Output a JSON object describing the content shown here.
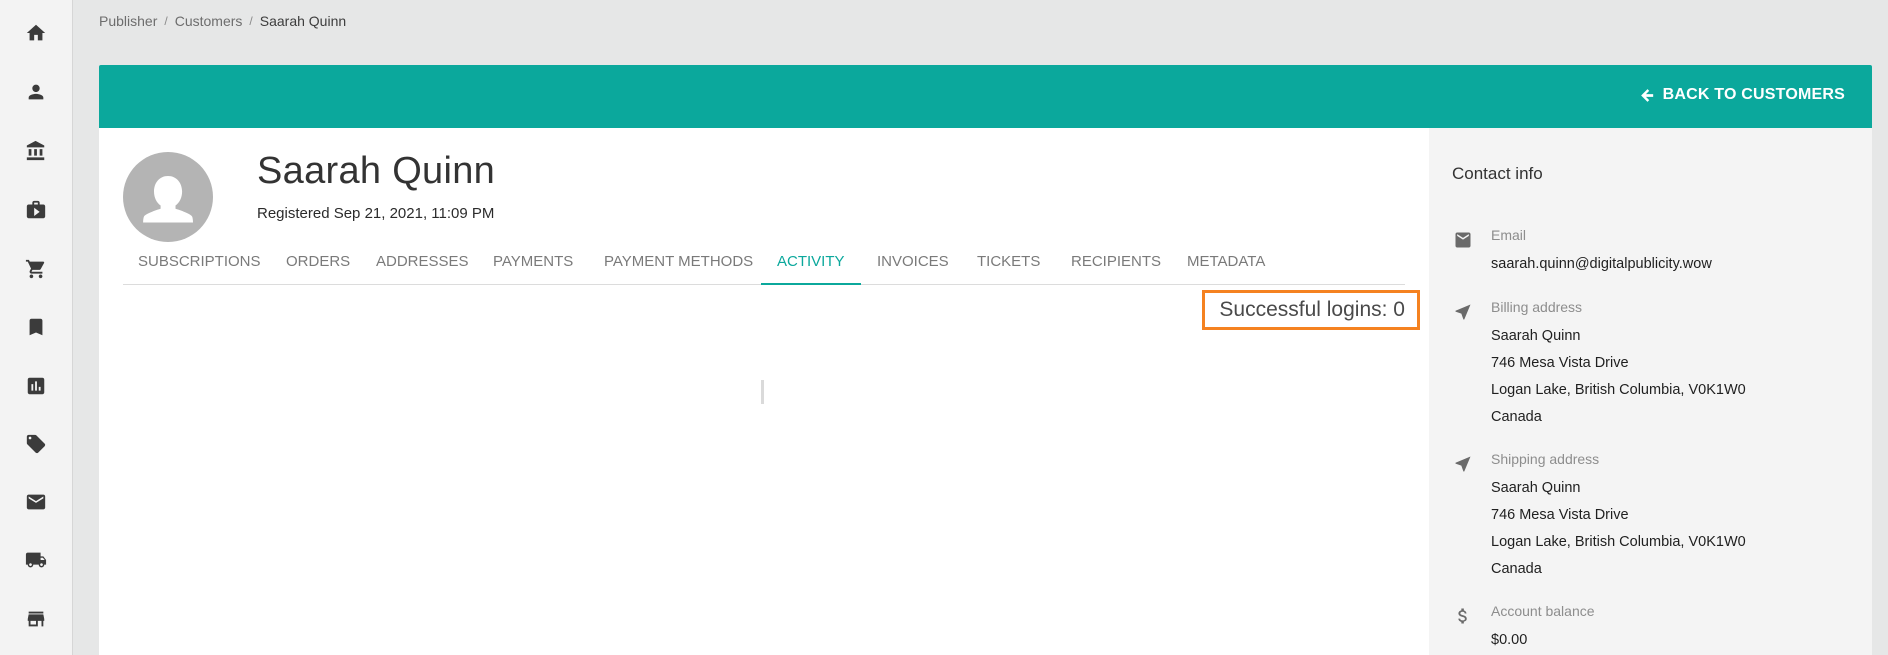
{
  "breadcrumb": {
    "items": [
      "Publisher",
      "Customers"
    ],
    "separator": "/",
    "current": "Saarah Quinn"
  },
  "sidebar": {
    "icons": [
      "home-icon",
      "person-icon",
      "bank-icon",
      "briefcase-play-icon",
      "cart-icon",
      "bookmark-icon",
      "bar-chart-icon",
      "ticket-icon",
      "mail-icon",
      "truck-icon",
      "store-icon"
    ]
  },
  "header": {
    "back_label": "BACK TO CUSTOMERS",
    "color": "#0ba89c"
  },
  "customer": {
    "name": "Saarah Quinn",
    "registered": "Registered Sep 21, 2021, 11:09 PM"
  },
  "tabs": [
    {
      "label": "SUBSCRIPTIONS"
    },
    {
      "label": "ORDERS"
    },
    {
      "label": "ADDRESSES"
    },
    {
      "label": "PAYMENTS"
    },
    {
      "label": "PAYMENT METHODS"
    },
    {
      "label": "ACTIVITY",
      "active": true
    },
    {
      "label": "INVOICES"
    },
    {
      "label": "TICKETS"
    },
    {
      "label": "RECIPIENTS"
    },
    {
      "label": "METADATA"
    }
  ],
  "activity": {
    "successful_logins": "Successful logins: 0",
    "highlight_color": "#f58220"
  },
  "contact": {
    "title": "Contact info",
    "email": {
      "label": "Email",
      "value": "saarah.quinn@digitalpublicity.wow"
    },
    "billing": {
      "label": "Billing address",
      "name": "Saarah Quinn",
      "street": "746 Mesa Vista Drive",
      "city": "Logan Lake, British Columbia, V0K1W0",
      "country": "Canada"
    },
    "shipping": {
      "label": "Shipping address",
      "name": "Saarah Quinn",
      "street": "746 Mesa Vista Drive",
      "city": "Logan Lake, British Columbia, V0K1W0",
      "country": "Canada"
    },
    "balance": {
      "label": "Account balance",
      "value": "$0.00"
    }
  }
}
